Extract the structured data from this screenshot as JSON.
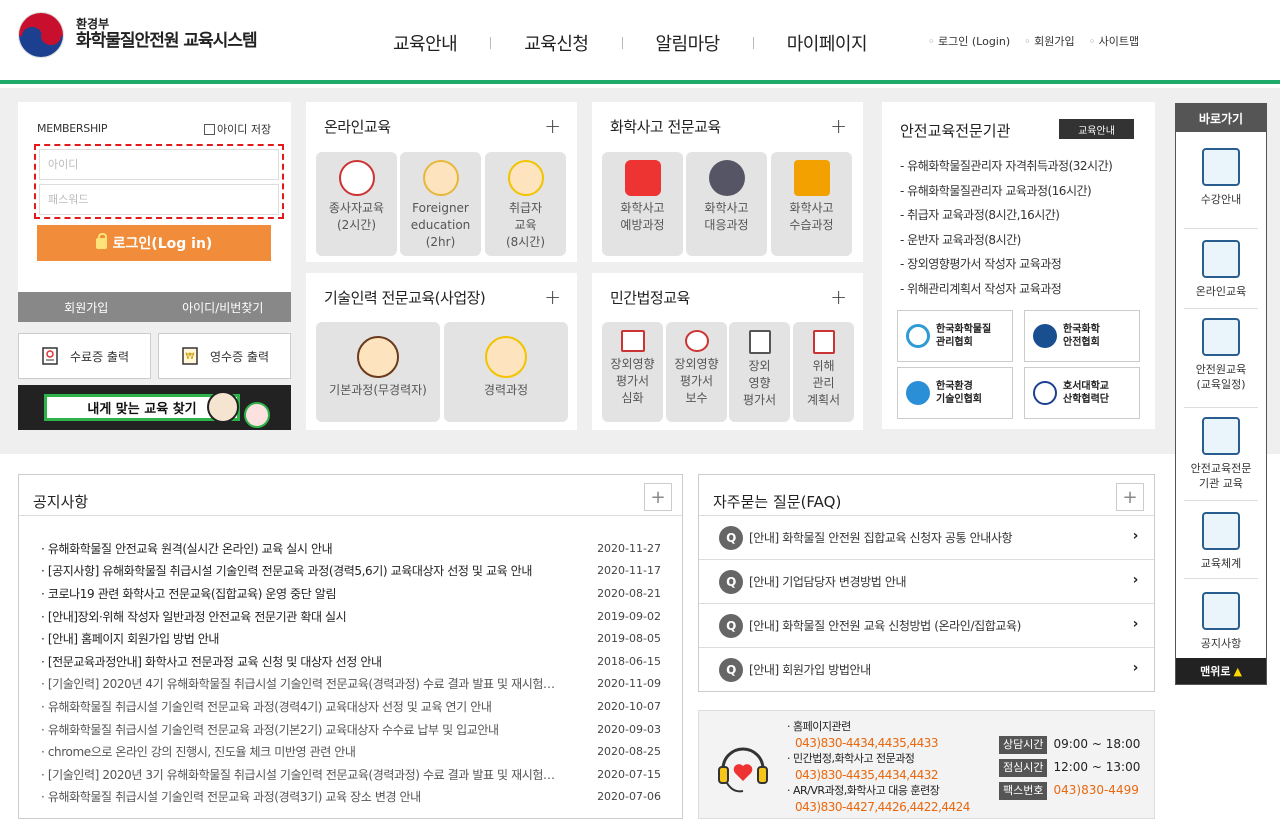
{
  "header": {
    "logo_sub": "환경부",
    "logo_main": "화학물질안전원 교육시스템",
    "nav": [
      "교육안내",
      "교육신청",
      "알림마당",
      "마이페이지"
    ],
    "util": [
      "로그인 (Login)",
      "회원가입",
      "사이트맵"
    ]
  },
  "login": {
    "title": "MEMBERSHIP",
    "save_id": "아이디 저장",
    "id_placeholder": "아이디",
    "pw_placeholder": "패스워드",
    "login_label": "로그인(Log in)",
    "join": "회원가입",
    "find_id": "아이디/비번찾기",
    "cert": "수료증 출력",
    "receipt": "영수증 출력",
    "find_course": "내게 맞는 교육 찾기"
  },
  "cards": {
    "online": {
      "title": "온라인교육",
      "tiles": [
        "종사자교육\n(2시간)",
        "Foreigner\neducation\n(2hr)",
        "취급자\n교육\n(8시간)"
      ]
    },
    "accident": {
      "title": "화학사고 전문교육",
      "tiles": [
        "화학사고\n예방과정",
        "화학사고\n대응과정",
        "화학사고\n수습과정"
      ]
    },
    "tech": {
      "title": "기술인력 전문교육(사업장)",
      "tiles": [
        "기본과정(무경력자)",
        "경력과정"
      ]
    },
    "civil": {
      "title": "민간법정교육",
      "tiles": [
        "장외영향\n평가서\n심화",
        "장외영향\n평가서\n보수",
        "장외\n영향\n평가서",
        "위해\n관리\n계획서"
      ]
    }
  },
  "institutions": {
    "title": "안전교육전문기관",
    "badge": "교육안내",
    "list": [
      "유해화학물질관리자 자격취득과정(32시간)",
      "유해화학물질관리자 교육과정(16시간)",
      "취급자 교육과정(8시간,16시간)",
      "운반자 교육과정(8시간)",
      "장외영향평가서 작성자 교육과정",
      "위해관리계획서 작성자 교육과정"
    ],
    "assoc": [
      "한국화학물질\n관리협회",
      "한국화학\n안전협회",
      "한국환경\n기술인협회",
      "호서대학교\n산학협력단"
    ]
  },
  "quick": {
    "title": "바로가기",
    "items": [
      "수강안내",
      "온라인교육",
      "안전원교육\n(교육일정)",
      "안전교육전문\n기관 교육",
      "교육체계",
      "공지사항"
    ],
    "top": "맨위로"
  },
  "notice": {
    "title": "공지사항",
    "items": [
      {
        "t": "유해화학물질 안전교육 원격(실시간 온라인) 교육 실시 안내",
        "d": "2020-11-27"
      },
      {
        "t": "[공지사항] 유해화학물질 취급시설 기술인력 전문교육 과정(경력5,6기) 교육대상자 선정 및 교육 안내",
        "d": "2020-11-17"
      },
      {
        "t": "코로나19 관련 화학사고 전문교육(집합교육) 운영 중단 알림",
        "d": "2020-08-21"
      },
      {
        "t": "[안내]장외·위해 작성자 일반과정 안전교육 전문기관 확대 실시",
        "d": "2019-09-02"
      },
      {
        "t": "[안내] 홈페이지 회원가입 방법 안내",
        "d": "2019-08-05"
      },
      {
        "t": "[전문교육과정안내] 화학사고 전문과정 교육 신청 및 대상자 선정 안내",
        "d": "2018-06-15"
      },
      {
        "t": "[기술인력] 2020년 4기 유해화학물질 취급시설 기술인력 전문교육(경력과정) 수료 결과 발표 및 재시험…",
        "d": "2020-11-09"
      },
      {
        "t": "유해화학물질 취급시설 기술인력 전문교육 과정(경력4기) 교육대상자 선정 및 교육 연기 안내",
        "d": "2020-10-07"
      },
      {
        "t": "유해화학물질 취급시설 기술인력 전문교육 과정(기본2기) 교육대상자 수수료 납부 및 입교안내",
        "d": "2020-09-03"
      },
      {
        "t": "chrome으로 온라인 강의 진행시, 진도율 체크 미반영 관련 안내",
        "d": "2020-08-25"
      },
      {
        "t": "[기술인력] 2020년 3기 유해화학물질 취급시설 기술인력 전문교육(경력과정) 수료 결과 발표 및 재시험…",
        "d": "2020-07-15"
      },
      {
        "t": "유해화학물질 취급시설 기술인력 전문교육 과정(경력3기) 교육 장소 변경 안내",
        "d": "2020-07-06"
      }
    ]
  },
  "faq": {
    "title": "자주묻는 질문(FAQ)",
    "items": [
      "[안내] 화학물질 안전원 집합교육 신청자 공통 안내사항",
      "[안내] 기업담당자 변경방법 안내",
      "[안내] 화학물질 안전원 교육 신청방법 (온라인/집합교육)",
      "[안내] 회원가입 방법안내"
    ]
  },
  "contact": {
    "items": [
      {
        "lbl": "홈페이지관련",
        "num": "043)830-4434,4435,4433"
      },
      {
        "lbl": "민간법정,화학사고 전문과정",
        "num": "043)830-4435,4434,4432"
      },
      {
        "lbl": "AR/VR과정,화학사고 대응 훈련장",
        "num": "043)830-4427,4426,4422,4424"
      }
    ],
    "info": [
      {
        "tag": "상담시간",
        "val": "09:00 ~ 18:00"
      },
      {
        "tag": "점심시간",
        "val": "12:00 ~ 13:00"
      },
      {
        "tag": "팩스번호",
        "val": "043)830-4499"
      }
    ]
  }
}
